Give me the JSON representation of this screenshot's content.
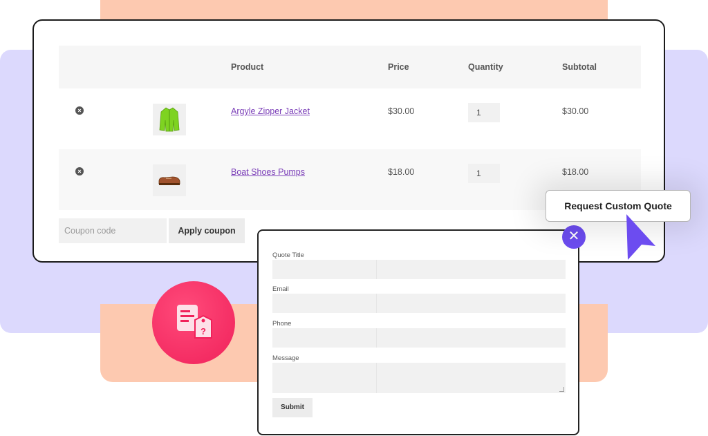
{
  "cart": {
    "headers": {
      "product": "Product",
      "price": "Price",
      "quantity": "Quantity",
      "subtotal": "Subtotal"
    },
    "items": [
      {
        "name": "Argyle Zipper Jacket",
        "price": "$30.00",
        "qty": "1",
        "subtotal": "$30.00",
        "remove_icon": "remove-circle-icon"
      },
      {
        "name": "Boat Shoes Pumps",
        "price": "$18.00",
        "qty": "1",
        "subtotal": "$18.00",
        "remove_icon": "remove-circle-icon"
      }
    ],
    "coupon_placeholder": "Coupon code",
    "apply_label": "Apply coupon"
  },
  "quote_button": {
    "label": "Request Custom Quote"
  },
  "form": {
    "title_label": "Quote Title",
    "email_label": "Email",
    "phone_label": "Phone",
    "message_label": "Message",
    "submit_label": "Submit"
  },
  "colors": {
    "accent": "#6c4cf0",
    "link": "#7b3fb8",
    "badge": "#f0215a",
    "lavender": "#dcd9fd",
    "peach": "#fdc9b0"
  }
}
